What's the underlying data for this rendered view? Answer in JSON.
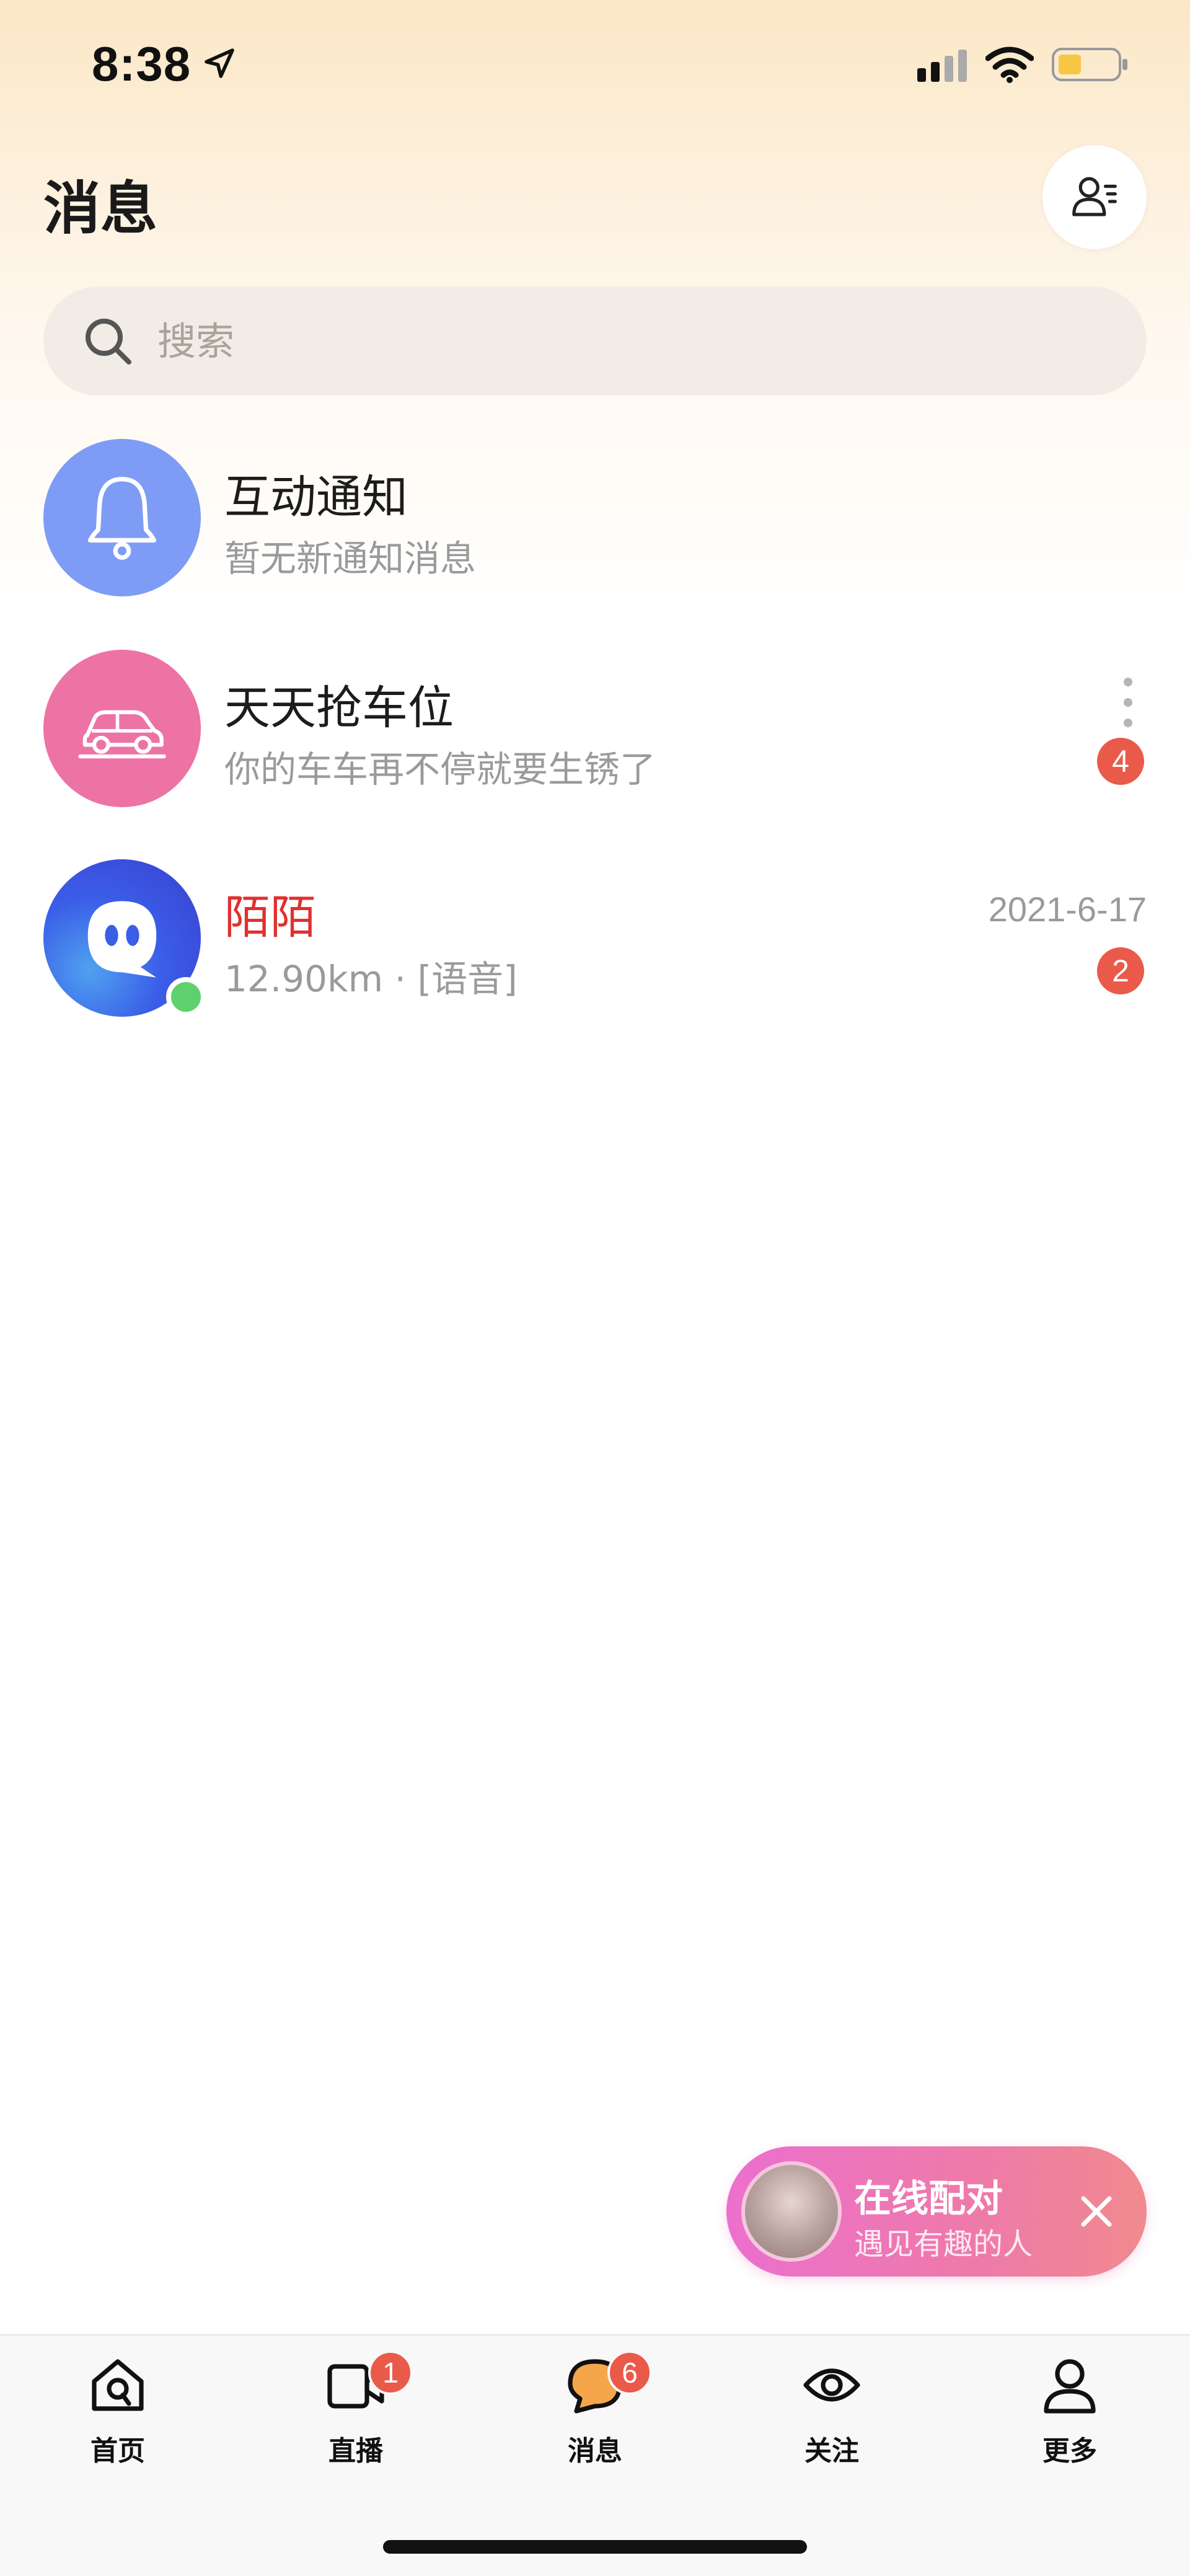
{
  "status_bar": {
    "time": "8:38"
  },
  "header": {
    "title": "消息",
    "contacts_icon": "contacts-icon"
  },
  "search": {
    "placeholder": "搜索"
  },
  "conversations": [
    {
      "title": "互动通知",
      "subtitle": "暂无新通知消息",
      "avatar_color": "#7e9cf5",
      "icon": "bell-icon"
    },
    {
      "title": "天天抢车位",
      "subtitle": "你的车车再不停就要生锈了",
      "badge": "4",
      "avatar_color": "#ed73a5",
      "icon": "car-icon"
    },
    {
      "title": "陌陌",
      "subtitle": "12.90km · [语音]",
      "time": "2021-6-17",
      "badge": "2",
      "title_color": "#e0302f",
      "online": true,
      "icon": "momo-logo-icon"
    }
  ],
  "match_pill": {
    "title": "在线配对",
    "subtitle": "遇见有趣的人"
  },
  "tabbar": {
    "tabs": [
      {
        "label": "首页",
        "icon": "home-icon"
      },
      {
        "label": "直播",
        "icon": "live-video-icon",
        "badge": "1"
      },
      {
        "label": "消息",
        "icon": "message-icon",
        "badge": "6",
        "active": true
      },
      {
        "label": "关注",
        "icon": "eye-icon"
      },
      {
        "label": "更多",
        "icon": "person-icon"
      }
    ]
  },
  "colors": {
    "badge": "#ea5a4a",
    "accent_orange": "#f5a64a",
    "online": "#5fd06e"
  }
}
